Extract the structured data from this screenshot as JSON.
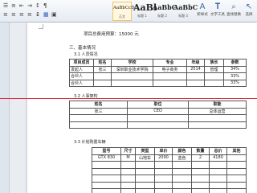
{
  "ribbon": {
    "styles": [
      {
        "sample": "AaBbCcDc",
        "label": "正文"
      },
      {
        "sample": "AaBl",
        "label": "标题 1"
      },
      {
        "sample": "AaBbC",
        "label": "标题 2"
      },
      {
        "sample": "AaBbC",
        "label": "标题 3"
      }
    ],
    "new_style_label": "新样式",
    "text_tools_label": "文字工具",
    "find_replace_label": "查找替换",
    "select_label": "选择"
  },
  "document": {
    "budget_line": "项目总费用预算：15000 元",
    "section3_title": "三、基本情况",
    "s31_title": "3.1 人员情况",
    "t1": {
      "headers": [
        "项目成员",
        "姓名",
        "学校",
        "专业",
        "年级",
        "族长",
        "参数"
      ],
      "rows": [
        [
          "发起人",
          "张三",
          "深圳职业技术学院",
          "电子商务",
          "2014",
          "管理",
          "34%"
        ],
        [
          "合伙人",
          "",
          "",
          "",
          "",
          "",
          "33%"
        ],
        [
          "合伙人",
          "",
          "",
          "",
          "",
          "",
          "33%"
        ]
      ]
    },
    "s32_title": "3.2 人事架构",
    "t2": {
      "headers": [
        "姓名",
        "职位",
        "职能"
      ],
      "rows": [
        [
          "张三",
          "CEO",
          "总体运营"
        ],
        [
          "",
          "",
          ""
        ],
        [
          "",
          "",
          ""
        ]
      ]
    },
    "s33_title": "3.3 计划购置车辆",
    "t3": {
      "headers": [
        "型号",
        "尺寸",
        "类型",
        "单价",
        "颜色",
        "数量",
        "总价",
        "其他"
      ],
      "rows": [
        [
          "GTX 830",
          "M",
          "山地车",
          "2090",
          "蓝色",
          "2",
          "4180",
          ""
        ],
        [
          "",
          "",
          "",
          "",
          "",
          "",
          "",
          ""
        ],
        [
          "",
          "",
          "",
          "",
          "",
          "",
          "",
          ""
        ],
        [
          "",
          "",
          "",
          "",
          "",
          "",
          "",
          ""
        ],
        [
          "",
          "",
          "",
          "",
          "",
          "",
          "",
          ""
        ],
        [
          "",
          "",
          "",
          "",
          "",
          "",
          "",
          ""
        ]
      ]
    }
  }
}
